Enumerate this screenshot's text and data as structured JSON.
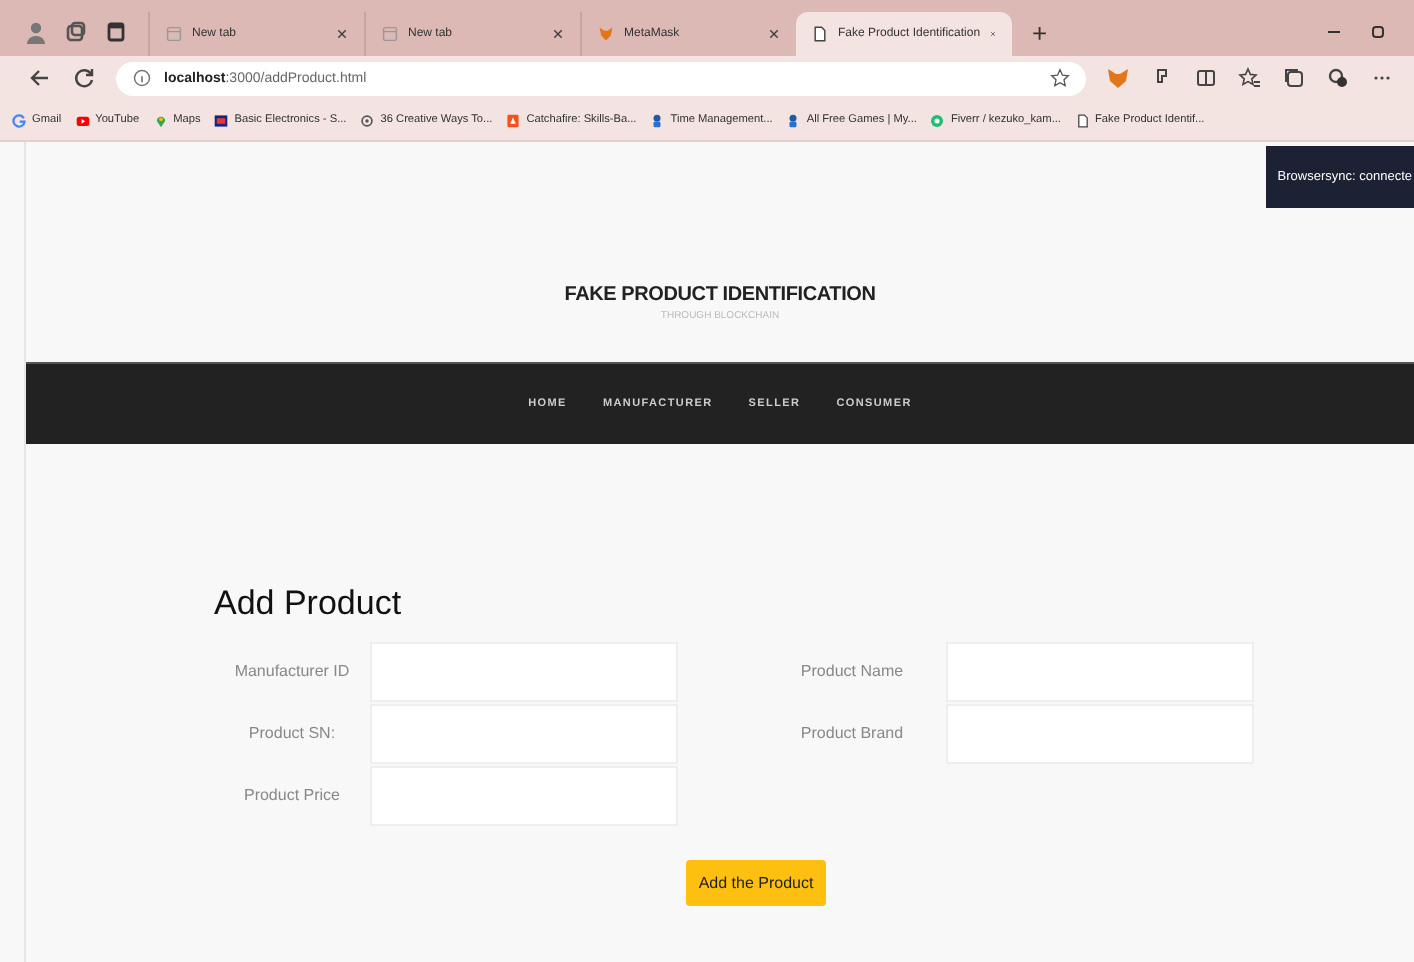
{
  "browser": {
    "tabs": [
      {
        "title": "New tab",
        "kind": "page",
        "selected": false
      },
      {
        "title": "New tab",
        "kind": "page",
        "selected": false
      },
      {
        "title": "MetaMask",
        "kind": "fox",
        "selected": false
      },
      {
        "title": "Fake Product Identification",
        "kind": "doc",
        "selected": true
      }
    ],
    "new_tab": "+",
    "address": {
      "host": "localhost",
      "path": ":3000/addProduct.html"
    },
    "bookmarks": [
      {
        "label": "Gmail",
        "kind": "google"
      },
      {
        "label": "YouTube",
        "kind": "youtube"
      },
      {
        "label": "Maps",
        "kind": "pin"
      },
      {
        "label": "Basic Electronics - S...",
        "kind": "square"
      },
      {
        "label": "36 Creative Ways To...",
        "kind": "ring"
      },
      {
        "label": "Catchafire: Skills-Ba...",
        "kind": "badge"
      },
      {
        "label": "Time Management...",
        "kind": "figure"
      },
      {
        "label": "All Free Games | My...",
        "kind": "figure"
      },
      {
        "label": "Fiverr / kezuko_kam...",
        "kind": "green"
      },
      {
        "label": "Fake Product Identif...",
        "kind": "doc"
      }
    ]
  },
  "toast": "Browsersync: connecte",
  "site": {
    "title": "FAKE PRODUCT IDENTIFICATION",
    "subtitle": "THROUGH BLOCKCHAIN",
    "nav": [
      "HOME",
      "MANUFACTURER",
      "SELLER",
      "CONSUMER"
    ]
  },
  "form": {
    "heading": "Add Product",
    "columns": [
      [
        {
          "label": "Manufacturer ID"
        },
        {
          "label": "Product SN:"
        },
        {
          "label": "Product Price"
        }
      ],
      [
        {
          "label": "Product Name"
        },
        {
          "label": "Product Brand"
        }
      ]
    ],
    "submit": "Add the Product"
  }
}
